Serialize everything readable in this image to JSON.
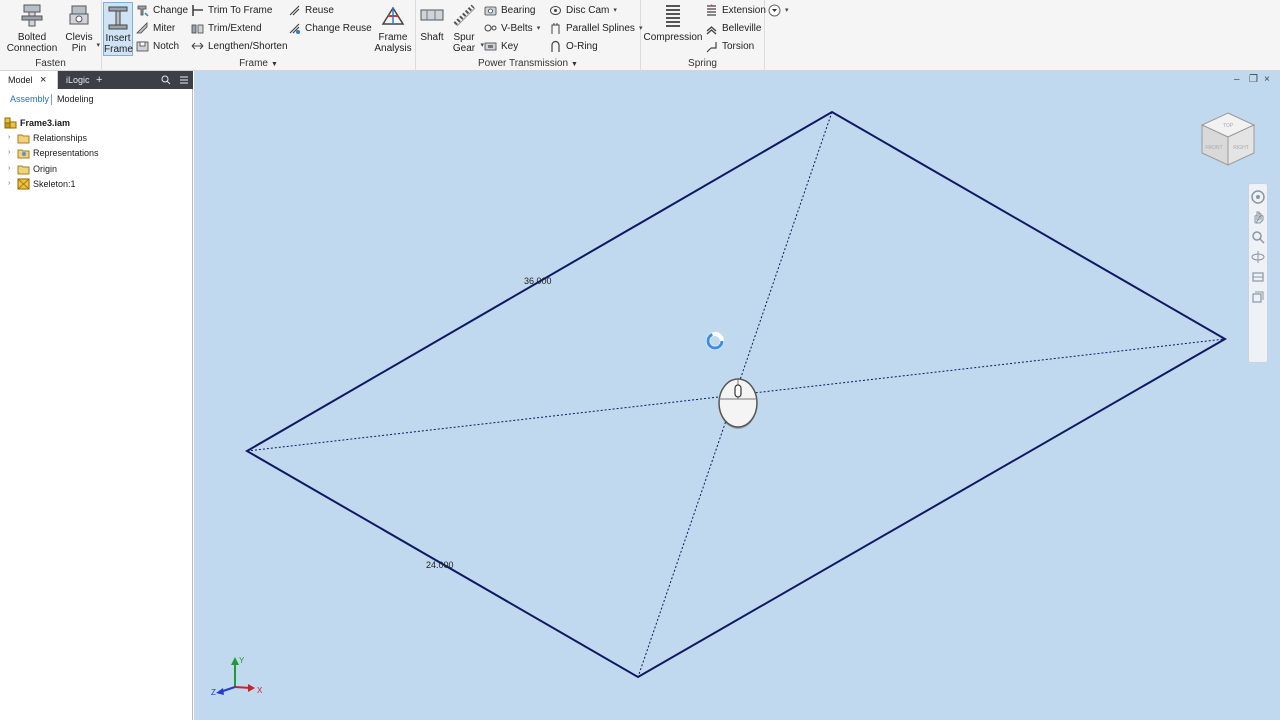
{
  "ribbon": {
    "fasten": {
      "title": "Fasten",
      "bolted_connection": "Bolted\nConnection",
      "clevis_pin": "Clevis\nPin"
    },
    "frame": {
      "title": "Frame",
      "insert_frame": "Insert\nFrame",
      "change": "Change",
      "miter": "Miter",
      "notch": "Notch",
      "trim_to_frame": "Trim To Frame",
      "trim_extend": "Trim/Extend",
      "lengthen_shorten": "Lengthen/Shorten",
      "reuse": "Reuse",
      "change_reuse": "Change Reuse",
      "frame_analysis": "Frame\nAnalysis"
    },
    "power_transmission": {
      "title": "Power Transmission",
      "shaft": "Shaft",
      "spur_gear": "Spur\nGear",
      "bearing": "Bearing",
      "v_belts": "V-Belts",
      "key": "Key",
      "disc_cam": "Disc Cam",
      "parallel_splines": "Parallel Splines",
      "o_ring": "O-Ring"
    },
    "spring": {
      "title": "Spring",
      "compression": "Compression",
      "extension": "Extension",
      "belleville": "Belleville",
      "torsion": "Torsion"
    }
  },
  "browser": {
    "tabs": [
      "Model",
      "iLogic"
    ],
    "close_glyph": "×",
    "add_glyph": "+",
    "sub_tabs": [
      "Assembly",
      "Modeling"
    ],
    "tree": [
      {
        "label": "Frame3.iam",
        "bold": true
      },
      {
        "label": "Relationships"
      },
      {
        "label": "Representations"
      },
      {
        "label": "Origin"
      },
      {
        "label": "Skeleton:1"
      }
    ]
  },
  "viewport": {
    "dimensions": [
      "36.000",
      "24.000"
    ],
    "viewcube_faces": [
      "TOP",
      "FRONT",
      "RIGHT"
    ],
    "triad_labels": [
      "X",
      "Y",
      "Z"
    ],
    "window_controls": [
      "–",
      "❐",
      "×"
    ]
  },
  "colors": {
    "viewport_bg": "#c1d9ee",
    "sketch_line": "#0b1a63",
    "accent": "#3a8ee6"
  }
}
